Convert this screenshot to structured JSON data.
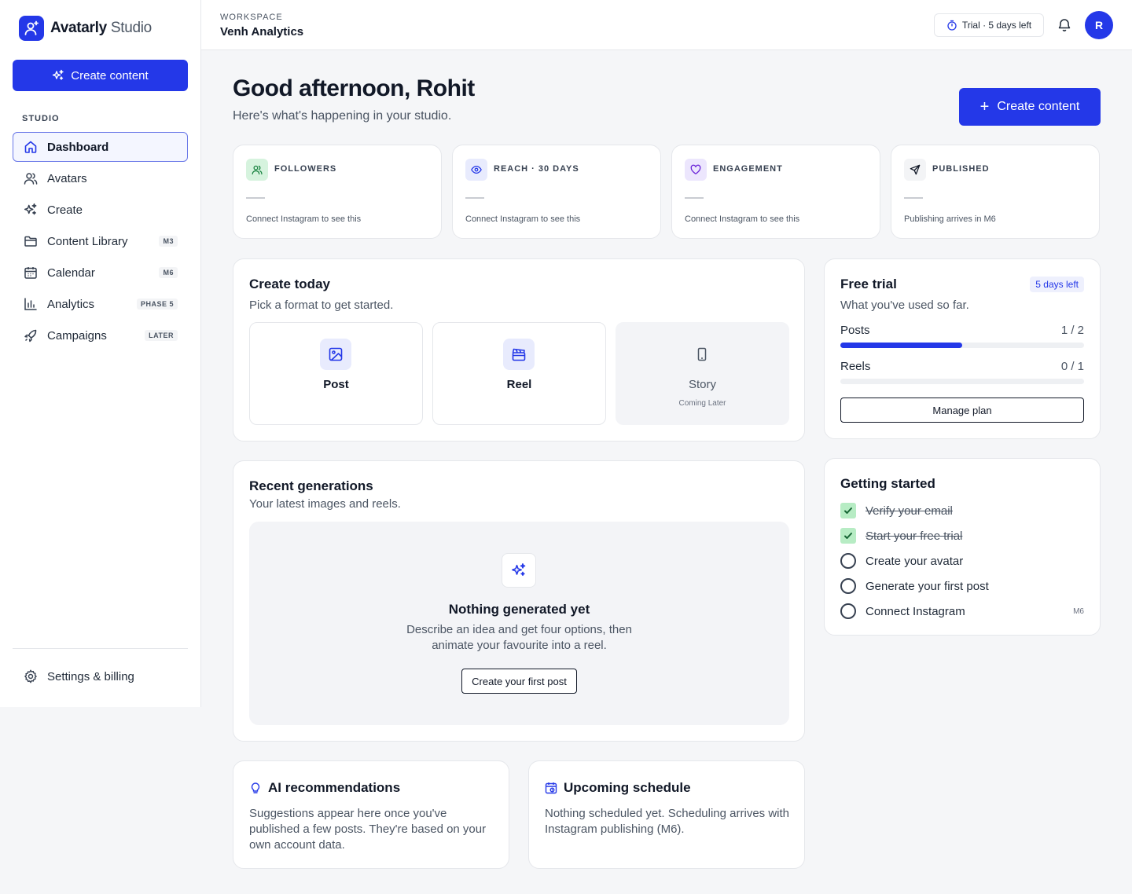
{
  "brand": {
    "name": "Avatarly",
    "suffix": "Studio"
  },
  "sidebar": {
    "create_label": "Create content",
    "section_label": "STUDIO",
    "items": [
      {
        "label": "Dashboard",
        "icon": "home-icon",
        "badge": ""
      },
      {
        "label": "Avatars",
        "icon": "users-icon",
        "badge": ""
      },
      {
        "label": "Create",
        "icon": "sparkles-icon",
        "badge": ""
      },
      {
        "label": "Content Library",
        "icon": "folder-icon",
        "badge": "M3"
      },
      {
        "label": "Calendar",
        "icon": "calendar-icon",
        "badge": "M6"
      },
      {
        "label": "Analytics",
        "icon": "bar-chart-icon",
        "badge": "PHASE 5"
      },
      {
        "label": "Campaigns",
        "icon": "rocket-icon",
        "badge": "LATER"
      }
    ],
    "settings_label": "Settings & billing"
  },
  "topbar": {
    "workspace_label": "WORKSPACE",
    "workspace_name": "Venh Analytics",
    "trial_label": "Trial · 5 days left",
    "avatar_initial": "R"
  },
  "header": {
    "greeting": "Good afternoon, Rohit",
    "subtitle": "Here's what's happening in your studio.",
    "create_label": "Create content"
  },
  "stats": [
    {
      "label": "FOLLOWERS",
      "value": "—",
      "note": "Connect Instagram to see this",
      "icon": "users-icon",
      "color": "#d6f3de"
    },
    {
      "label": "REACH · 30 DAYS",
      "value": "—",
      "note": "Connect Instagram to see this",
      "icon": "eye-icon",
      "color": "#e8ebfd"
    },
    {
      "label": "ENGAGEMENT",
      "value": "—",
      "note": "Connect Instagram to see this",
      "icon": "heart-icon",
      "color": "#ece6fd"
    },
    {
      "label": "PUBLISHED",
      "value": "—",
      "note": "Publishing arrives in M6",
      "icon": "send-icon",
      "color": "#f3f4f6"
    }
  ],
  "create_today": {
    "title": "Create today",
    "subtitle": "Pick a format to get started.",
    "formats": [
      {
        "label": "Post",
        "note": ""
      },
      {
        "label": "Reel",
        "note": ""
      },
      {
        "label": "Story",
        "note": "Coming Later"
      }
    ]
  },
  "free_trial": {
    "title": "Free trial",
    "badge": "5 days left",
    "subtitle": "What you've used so far.",
    "usage": [
      {
        "label": "Posts",
        "value": "1 / 2",
        "used": 1,
        "limit": 2
      },
      {
        "label": "Reels",
        "value": "0 / 1",
        "used": 0,
        "limit": 1
      }
    ],
    "manage_label": "Manage plan"
  },
  "recent": {
    "title": "Recent generations",
    "subtitle": "Your latest images and reels.",
    "empty_title": "Nothing generated yet",
    "empty_desc": "Describe an idea and get four options, then animate your favourite into a reel.",
    "empty_button": "Create your first post"
  },
  "getting_started": {
    "title": "Getting started",
    "items": [
      {
        "label": "Verify your email",
        "done": true,
        "badge": ""
      },
      {
        "label": "Start your free trial",
        "done": true,
        "badge": ""
      },
      {
        "label": "Create your avatar",
        "done": false,
        "badge": ""
      },
      {
        "label": "Generate your first post",
        "done": false,
        "badge": ""
      },
      {
        "label": "Connect Instagram",
        "done": false,
        "badge": "M6"
      }
    ]
  },
  "ai": {
    "title": "AI recommendations",
    "body": "Suggestions appear here once you've published a few posts. They're based on your own account data."
  },
  "schedule": {
    "title": "Upcoming schedule",
    "body": "Nothing scheduled yet. Scheduling arrives with Instagram publishing (M6)."
  },
  "colors": {
    "accent": "#2438e8",
    "success": "#16a34a"
  }
}
